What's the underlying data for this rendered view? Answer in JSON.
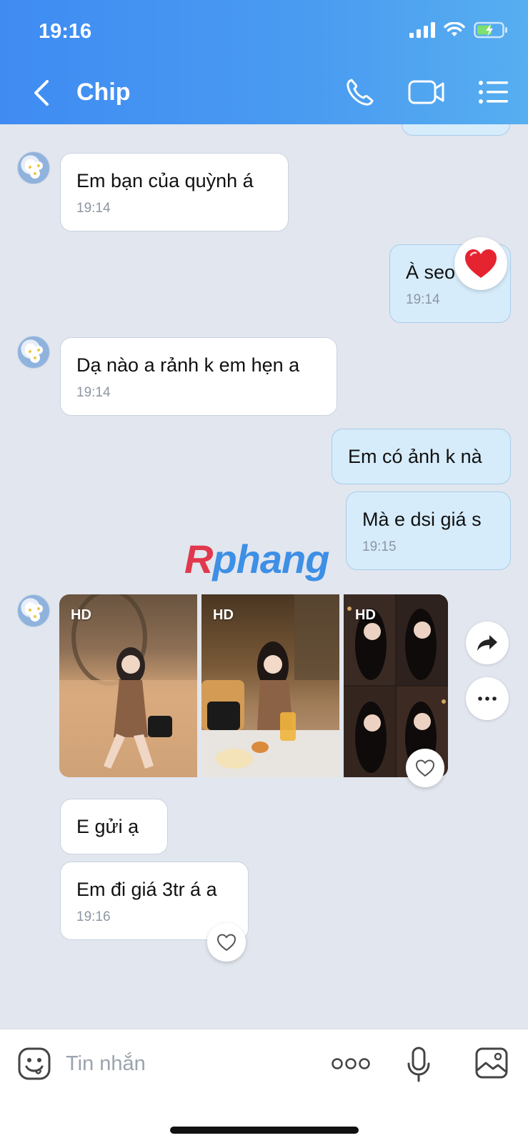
{
  "status": {
    "time": "19:16"
  },
  "header": {
    "title": "Chip"
  },
  "messages": {
    "m1": {
      "text": "Em bạn của quỳnh á",
      "time": "19:14"
    },
    "m2": {
      "text": "À seo",
      "time": "19:14",
      "reaction": "heart"
    },
    "m3": {
      "text": "Dạ nào a rảnh k em hẹn a",
      "time": "19:14"
    },
    "m4": {
      "text": "Em có ảnh k nà"
    },
    "m5": {
      "text": "Mà e dsi giá s",
      "time": "19:15"
    },
    "photos": {
      "badge": "HD",
      "count": 3
    },
    "m6": {
      "text": "E gửi ạ"
    },
    "m7": {
      "text": "Em đi giá 3tr á a",
      "time": "19:16"
    }
  },
  "watermark": {
    "first": "R",
    "rest": "phang"
  },
  "input": {
    "placeholder": "Tin nhắn"
  },
  "colors": {
    "header": "#4a9cf1",
    "incoming": "#ffffff",
    "outgoing": "#d6ecfb",
    "background": "#e2e6ee"
  }
}
